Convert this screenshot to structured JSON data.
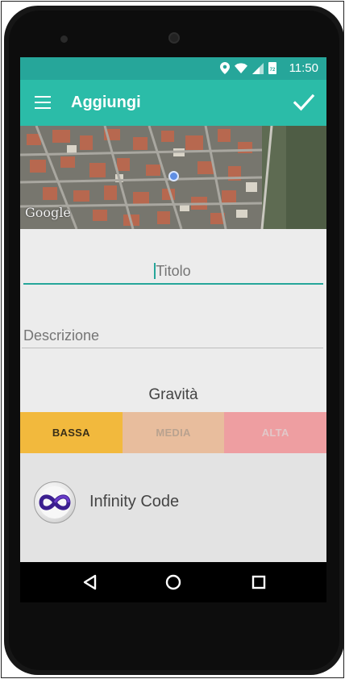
{
  "status_bar": {
    "time": "11:50",
    "icons": [
      "location-icon",
      "wifi-icon",
      "signal-icon",
      "battery-icon"
    ],
    "battery_level": "72"
  },
  "app_bar": {
    "title": "Aggiungi",
    "menu_icon": "hamburger-menu-icon",
    "confirm_icon": "check-icon"
  },
  "map": {
    "provider_label": "Google"
  },
  "form": {
    "title_placeholder": "Titolo",
    "description_placeholder": "Descrizione"
  },
  "severity": {
    "label": "Gravità",
    "options": [
      {
        "label": "BASSA",
        "selected": true,
        "color": "#f2b93d"
      },
      {
        "label": "MEDIA",
        "selected": false,
        "color": "#e8bd9d"
      },
      {
        "label": "ALTA",
        "selected": false,
        "color": "#ee9ea1"
      }
    ]
  },
  "footer": {
    "company": "Infinity Code",
    "logo_icon": "infinity-logo-icon"
  },
  "nav_bar": {
    "buttons": [
      "back-icon",
      "home-icon",
      "recents-icon"
    ]
  },
  "colors": {
    "accent": "#26a69a",
    "app_bar": "#2bbca8"
  }
}
